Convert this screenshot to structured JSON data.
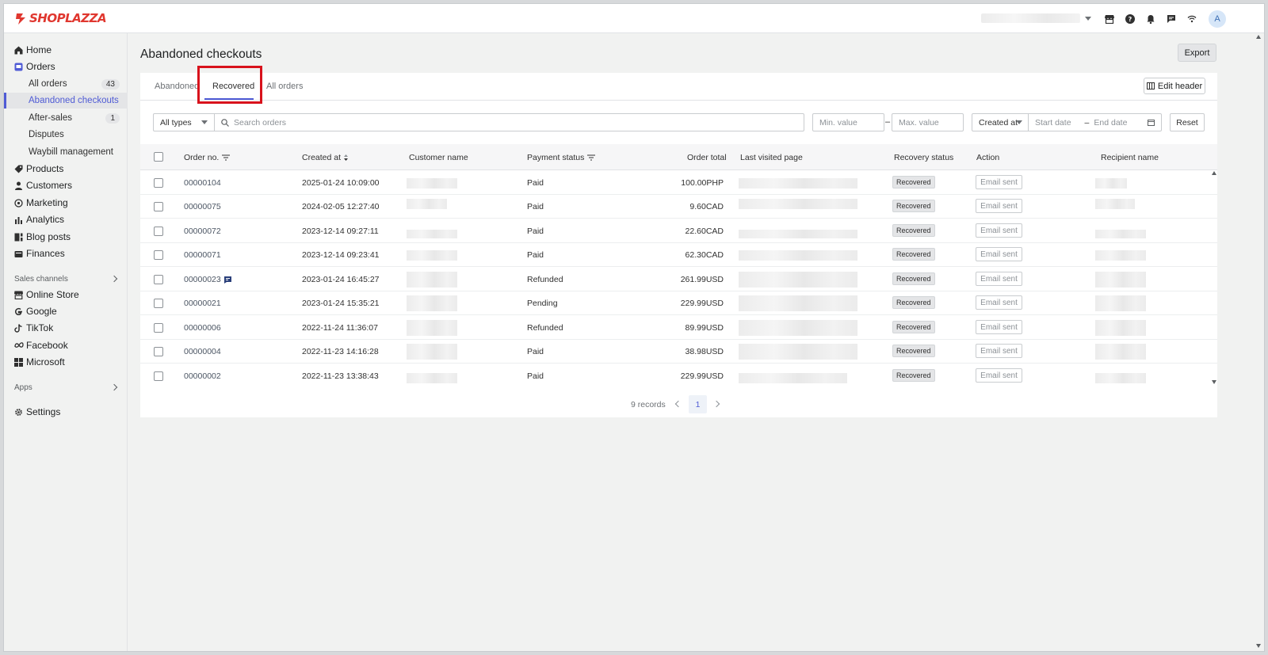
{
  "brand": {
    "name": "SHOPLAZZA",
    "color": "#e0372f"
  },
  "topbar": {
    "avatar_letter": "A",
    "icons": [
      "store-icon",
      "help-icon",
      "bell-icon",
      "chat-icon",
      "wifi-icon"
    ]
  },
  "sidebar": {
    "home": "Home",
    "orders": "Orders",
    "all_orders": "All orders",
    "all_orders_count": "43",
    "abandoned_checkouts": "Abandoned checkouts",
    "after_sales": "After-sales",
    "after_sales_count": "1",
    "disputes": "Disputes",
    "waybill": "Waybill management",
    "products": "Products",
    "customers": "Customers",
    "marketing": "Marketing",
    "analytics": "Analytics",
    "blog_posts": "Blog posts",
    "finances": "Finances",
    "sales_channels": "Sales channels",
    "online_store": "Online Store",
    "google": "Google",
    "tiktok": "TikTok",
    "facebook": "Facebook",
    "microsoft": "Microsoft",
    "apps": "Apps",
    "settings": "Settings"
  },
  "page": {
    "title": "Abandoned checkouts",
    "export_label": "Export"
  },
  "tabs": {
    "abandoned": "Abandoned",
    "recovered": "Recovered",
    "all_orders": "All orders",
    "edit_header": "Edit header"
  },
  "filters": {
    "type_select": "All types",
    "search_placeholder": "Search orders",
    "min_placeholder": "Min. value",
    "max_placeholder": "Max. value",
    "date_field": "Created at",
    "start_placeholder": "Start date",
    "end_placeholder": "End date",
    "reset_label": "Reset",
    "range_dash": "–"
  },
  "table": {
    "headers": {
      "order_no": "Order no.",
      "created_at": "Created at",
      "customer_name": "Customer name",
      "payment_status": "Payment status",
      "order_total": "Order total",
      "last_visited": "Last visited page",
      "recovery_status": "Recovery status",
      "action": "Action",
      "recipient": "Recipient name"
    },
    "rows": [
      {
        "order": "00000104",
        "created": "2025-01-24 10:09:00",
        "payment": "Paid",
        "total": "100.00PHP",
        "recovery": "Recovered",
        "action": "Email sent"
      },
      {
        "order": "00000075",
        "created": "2024-02-05 12:27:40",
        "payment": "Paid",
        "total": "9.60CAD",
        "recovery": "Recovered",
        "action": "Email sent"
      },
      {
        "order": "00000072",
        "created": "2023-12-14 09:27:11",
        "payment": "Paid",
        "total": "22.60CAD",
        "recovery": "Recovered",
        "action": "Email sent"
      },
      {
        "order": "00000071",
        "created": "2023-12-14 09:23:41",
        "payment": "Paid",
        "total": "62.30CAD",
        "recovery": "Recovered",
        "action": "Email sent"
      },
      {
        "order": "00000023",
        "created": "2023-01-24 16:45:27",
        "payment": "Refunded",
        "total": "261.99USD",
        "recovery": "Recovered",
        "action": "Email sent"
      },
      {
        "order": "00000021",
        "created": "2023-01-24 15:35:21",
        "payment": "Pending",
        "total": "229.99USD",
        "recovery": "Recovered",
        "action": "Email sent"
      },
      {
        "order": "00000006",
        "created": "2022-11-24 11:36:07",
        "payment": "Refunded",
        "total": "89.99USD",
        "recovery": "Recovered",
        "action": "Email sent"
      },
      {
        "order": "00000004",
        "created": "2022-11-23 14:16:28",
        "payment": "Paid",
        "total": "38.98USD",
        "recovery": "Recovered",
        "action": "Email sent"
      },
      {
        "order": "00000002",
        "created": "2022-11-23 13:38:43",
        "payment": "Paid",
        "total": "229.99USD",
        "recovery": "Recovered",
        "action": "Email sent"
      }
    ]
  },
  "pagination": {
    "records": "9 records",
    "current_page": "1"
  },
  "colors": {
    "accent": "#4f5bd5",
    "highlight": "#d8121c"
  }
}
